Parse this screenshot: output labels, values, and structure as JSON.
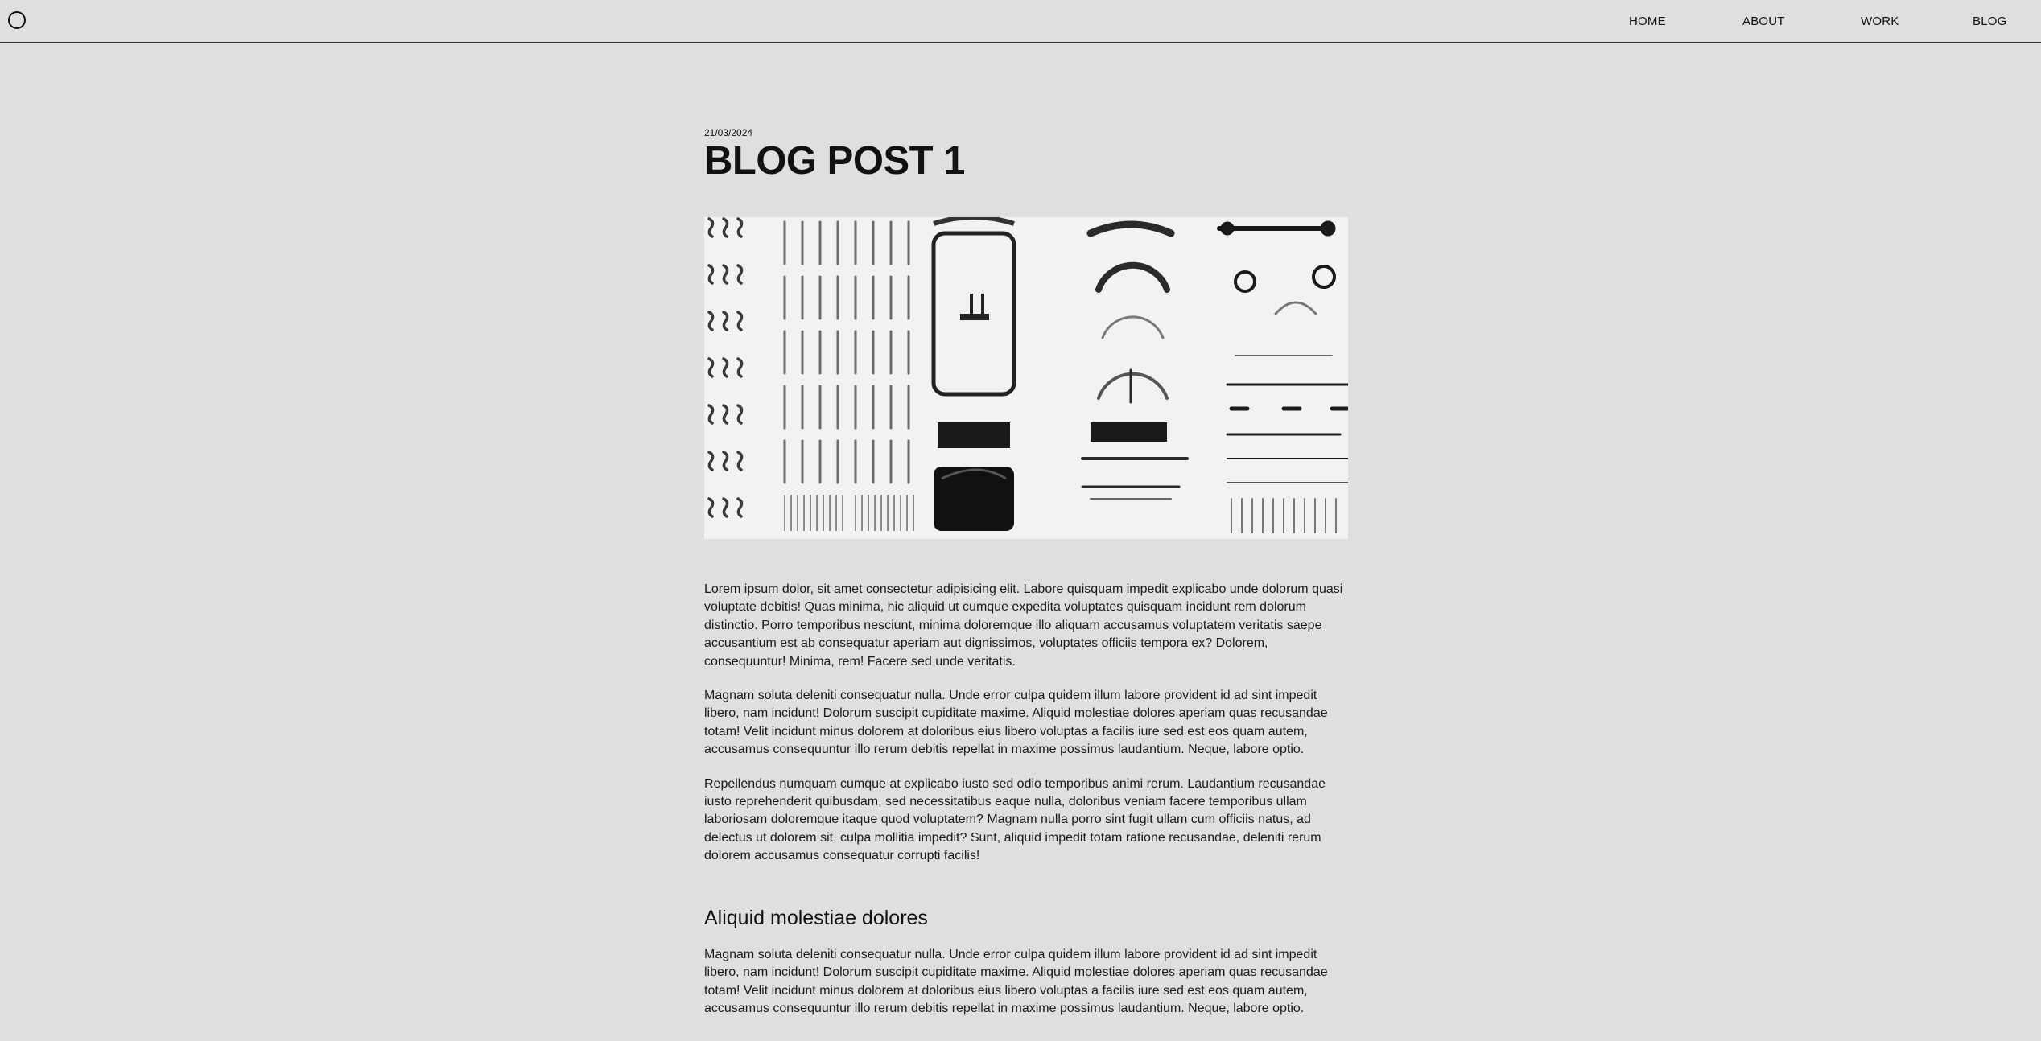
{
  "nav": {
    "logo": "circle-logo-icon",
    "links": [
      "HOME",
      "ABOUT",
      "WORK",
      "BLOG"
    ]
  },
  "post": {
    "date": "21/03/2024",
    "title": "BLOG POST 1",
    "image": "typewriter-parts-flatlay",
    "paragraphs": [
      "Lorem ipsum dolor, sit amet consectetur adipisicing elit. Labore quisquam impedit explicabo unde dolorum quasi voluptate debitis! Quas minima, hic aliquid ut cumque expedita voluptates quisquam incidunt rem dolorum distinctio. Porro temporibus nesciunt, minima doloremque illo aliquam accusamus voluptatem veritatis saepe accusantium est ab consequatur aperiam aut dignissimos, voluptates officiis tempora ex? Dolorem, consequuntur! Minima, rem! Facere sed unde veritatis.",
      "Magnam soluta deleniti consequatur nulla. Unde error culpa quidem illum labore provident id ad sint impedit libero, nam incidunt! Dolorum suscipit cupiditate maxime. Aliquid molestiae dolores aperiam quas recusandae totam! Velit incidunt minus dolorem at doloribus eius libero voluptas a facilis iure sed est eos quam autem, accusamus consequuntur illo rerum debitis repellat in maxime possimus laudantium. Neque, labore optio.",
      "Repellendus numquam cumque at explicabo iusto sed odio temporibus animi rerum. Laudantium recusandae iusto reprehenderit quibusdam, sed necessitatibus eaque nulla, doloribus veniam facere temporibus ullam laboriosam doloremque itaque quod voluptatem? Magnam nulla porro sint fugit ullam cum officiis natus, ad delectus ut dolorem sit, culpa mollitia impedit? Sunt, aliquid impedit totam ratione recusandae, deleniti rerum dolorem accusamus consequatur corrupti facilis!"
    ],
    "section_heading": "Aliquid molestiae dolores",
    "section_paragraph": "Magnam soluta deleniti consequatur nulla. Unde error culpa quidem illum labore provident id ad sint impedit libero, nam incidunt! Dolorum suscipit cupiditate maxime. Aliquid molestiae dolores aperiam quas recusandae totam! Velit incidunt minus dolorem at doloribus eius libero voluptas a facilis iure sed est eos quam autem, accusamus consequuntur illo rerum debitis repellat in maxime possimus laudantium. Neque, labore optio."
  }
}
